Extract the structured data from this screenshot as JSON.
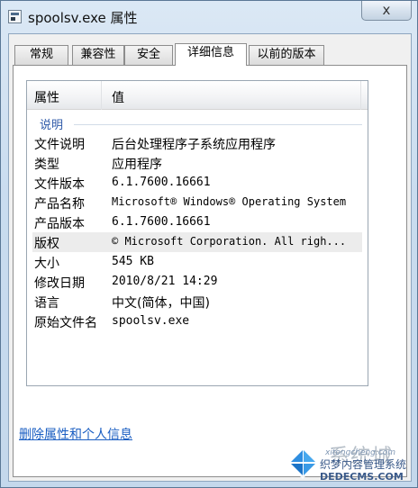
{
  "window": {
    "title": "spoolsv.exe 属性",
    "close_glyph": "x"
  },
  "tabs": [
    {
      "label": "常规",
      "active": false
    },
    {
      "label": "兼容性",
      "active": false
    },
    {
      "label": "安全",
      "active": false
    },
    {
      "label": "详细信息",
      "active": true
    },
    {
      "label": "以前的版本",
      "active": false
    }
  ],
  "list": {
    "columns": [
      "属性",
      "值"
    ],
    "group_label": "说明",
    "rows": [
      {
        "key": "文件说明",
        "value": "后台处理程序子系统应用程序"
      },
      {
        "key": "类型",
        "value": "应用程序"
      },
      {
        "key": "文件版本",
        "value": "6.1.7600.16661"
      },
      {
        "key": "产品名称",
        "value": "Microsoft® Windows® Operating System"
      },
      {
        "key": "产品版本",
        "value": "6.1.7600.16661"
      },
      {
        "key": "版权",
        "value": "© Microsoft Corporation. All righ..."
      },
      {
        "key": "大小",
        "value": "545 KB"
      },
      {
        "key": "修改日期",
        "value": "2010/8/21 14:29"
      },
      {
        "key": "语言",
        "value": "中文(简体，中国)"
      },
      {
        "key": "原始文件名",
        "value": "spoolsv.exe"
      }
    ]
  },
  "remove_link": "删除属性和个人信息",
  "watermark": {
    "big": "系统城",
    "small": "织梦内容管理系统",
    "url": "DEDECMS.COM",
    "url2": "xitongcheng.com"
  },
  "colors": {
    "link": "#1a5ec2",
    "group": "#2e59a8"
  }
}
